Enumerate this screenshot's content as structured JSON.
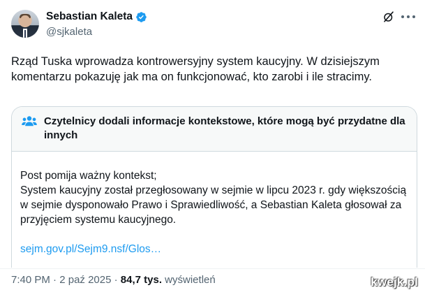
{
  "author": {
    "name": "Sebastian Kaleta",
    "handle": "@sjkaleta",
    "verified": true,
    "verified_color": "#1d9bf0"
  },
  "icons": {
    "grok": "grok-icon",
    "more": "more-horizontal-icon",
    "community": "people-icon",
    "verified": "verified-badge-icon"
  },
  "tweet": {
    "text": "Rząd Tuska wprowadza kontrowersyjny system kaucyjny. W dzisiejszym komentarzu pokazuję jak ma on funkcjonować, kto zarobi i ile stracimy."
  },
  "community_note": {
    "title": "Czytelnicy dodali informacje kontekstowe, które mogą być przydatne dla innych",
    "line1": "Post pomija ważny kontekst;",
    "line2": "System kaucyjny został przegłosowany w sejmie w lipcu 2023 r. gdy większością w sejmie dysponowało Prawo i Sprawiedliwość, a Sebastian Kaleta głosował za przyjęciem systemu kaucyjnego.",
    "link": "sejm.gov.pl/Sejm9.nsf/Glos…",
    "link_color": "#1d9bf0"
  },
  "meta": {
    "time": "7:40 PM",
    "separator": " · ",
    "date": "2 paź 2025",
    "views_count": "84,7 tys.",
    "views_label": " wyświetleń"
  },
  "watermark": "kwejk.pl"
}
